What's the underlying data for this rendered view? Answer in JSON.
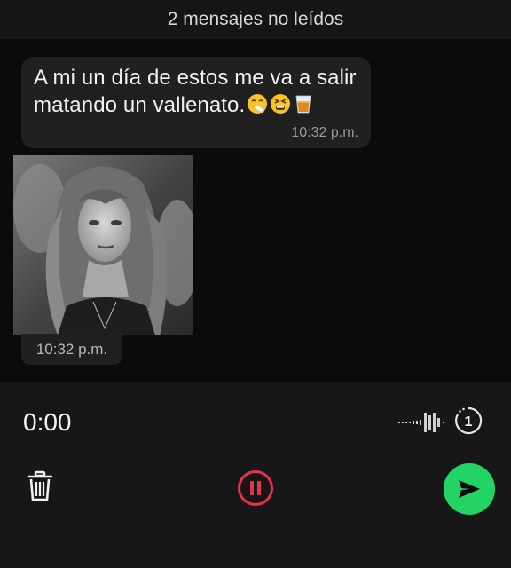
{
  "unread_banner": {
    "text": "2 mensajes no leídos"
  },
  "messages": [
    {
      "text": "A mi un día de estos me va a salir matando un vallenato.",
      "emojis": [
        "sneezing-face-emoji",
        "tired-face-emoji",
        "tumbler-glass-emoji"
      ],
      "time": "10:32 p.m."
    },
    {
      "media": "grayscale-photo-woman",
      "time": "10:32 p.m."
    }
  ],
  "recorder": {
    "elapsed": "0:00",
    "view_once_count": "1",
    "icons": [
      "waveform-icon",
      "view-once-timer-icon",
      "trash-icon",
      "pause-icon",
      "send-icon"
    ],
    "colors": {
      "pause": "#e5334f",
      "send": "#24d366"
    }
  }
}
